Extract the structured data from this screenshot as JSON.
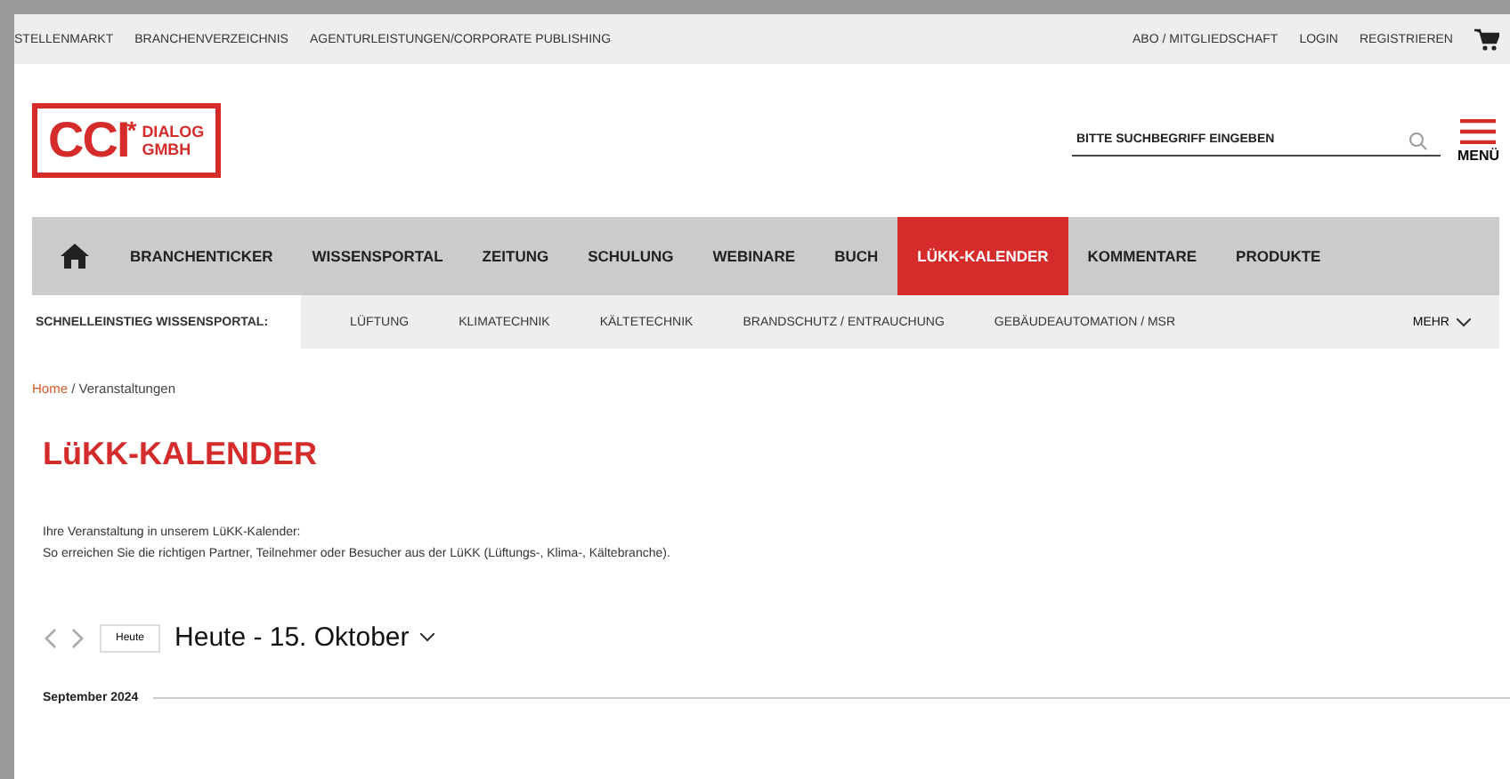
{
  "top_bar": {
    "left_links": [
      "STELLENMARKT",
      "BRANCHENVERZEICHNIS",
      "AGENTURLEISTUNGEN/CORPORATE PUBLISHING"
    ],
    "right_links": [
      "ABO / MITGLIEDSCHAFT",
      "LOGIN",
      "REGISTRIEREN"
    ]
  },
  "logo": {
    "mark": "CCI",
    "star": "*",
    "line1": "DIALOG",
    "line2": "GMBH"
  },
  "search": {
    "placeholder": "BITTE SUCHBEGRIFF EINGEBEN"
  },
  "menu": {
    "label": "MENÜ"
  },
  "nav": [
    {
      "label": "BRANCHENTICKER",
      "selected": false
    },
    {
      "label": "WISSENSPORTAL",
      "selected": false
    },
    {
      "label": "ZEITUNG",
      "selected": false
    },
    {
      "label": "SCHULUNG",
      "selected": false
    },
    {
      "label": "WEBINARE",
      "selected": false
    },
    {
      "label": "BUCH",
      "selected": false
    },
    {
      "label": "LÜKK-KALENDER",
      "selected": true
    },
    {
      "label": "KOMMENTARE",
      "selected": false
    },
    {
      "label": "PRODUKTE",
      "selected": false
    }
  ],
  "subnav": {
    "title": "SCHNELLEINSTIEG WISSENSPORTAL:",
    "items": [
      "LÜFTUNG",
      "KLIMATECHNIK",
      "KÄLTETECHNIK",
      "BRANDSCHUTZ / ENTRAUCHUNG",
      "GEBÄUDEAUTOMATION / MSR"
    ],
    "more": "MEHR"
  },
  "breadcrumb": {
    "home": "Home",
    "current": "/ Veranstaltungen"
  },
  "title": "LüKK-KALENDER",
  "intro": [
    "Ihre Veranstaltung in unserem LüKK-Kalender:",
    "So erreichen Sie die richtigen Partner, Teilnehmer oder Besucher aus der LüKK (Lüftungs-, Klima-, Kältebranche)."
  ],
  "calendar": {
    "today_button": "Heute",
    "heading": "Heute - 15. Oktober",
    "month": "September 2024"
  }
}
